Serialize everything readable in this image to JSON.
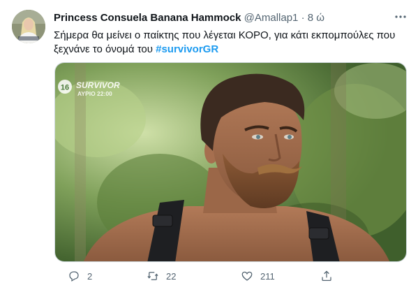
{
  "tweet": {
    "author_name": "Princess Consuela Banana Hammock",
    "handle": "@Amallap1",
    "separator": "·",
    "time": "8 ώ",
    "more_icon": "more-horizontal-icon",
    "text": "Σήμερα θα μείνει ο παίκτης που λέγεται ΚΟΡΟ, για κάτι εκπομπούλες που ξεχνάνε το όνομά του",
    "hashtag": "#survivorGR",
    "media": {
      "watermark_rating": "16",
      "watermark_brand": "SURVIVOR",
      "watermark_schedule": "ΑΥΡΙΟ 22:00"
    },
    "actions": {
      "replies": "2",
      "retweets": "22",
      "likes": "211"
    }
  }
}
